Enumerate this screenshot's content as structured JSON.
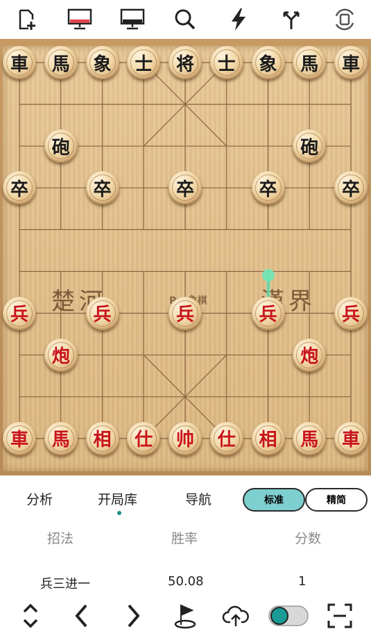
{
  "toolbar": {
    "icons": [
      "new-file-icon",
      "red-monitor-icon",
      "black-monitor-icon",
      "search-icon",
      "lightning-icon",
      "branch-icon",
      "rotate-icon"
    ]
  },
  "board": {
    "river_left": "楚河",
    "river_right": "漢界",
    "river_center": "Pro象棋",
    "black_pieces": {
      "r1": [
        "車",
        "馬",
        "象",
        "士",
        "将",
        "士",
        "象",
        "馬",
        "車"
      ],
      "cannon": "砲",
      "pawn": "卒"
    },
    "red_pieces": {
      "r1": [
        "車",
        "馬",
        "相",
        "仕",
        "帅",
        "仕",
        "相",
        "馬",
        "車"
      ],
      "cannon": "炮",
      "pawn": "兵"
    },
    "hint_color": "#5fe0b0"
  },
  "tabs": {
    "analysis": "分析",
    "opening_book": "开局库",
    "navigation": "导航",
    "standard": "标准",
    "simple": "精简"
  },
  "table": {
    "headers": [
      "招法",
      "胜率",
      "分数"
    ],
    "rows": [
      {
        "move": "兵三进一",
        "winrate": "50.08",
        "score": "1"
      }
    ]
  },
  "colors": {
    "accent": "#7ecfcf",
    "toggle": "#1a9b95",
    "red_piece_text": "#c8141c"
  }
}
